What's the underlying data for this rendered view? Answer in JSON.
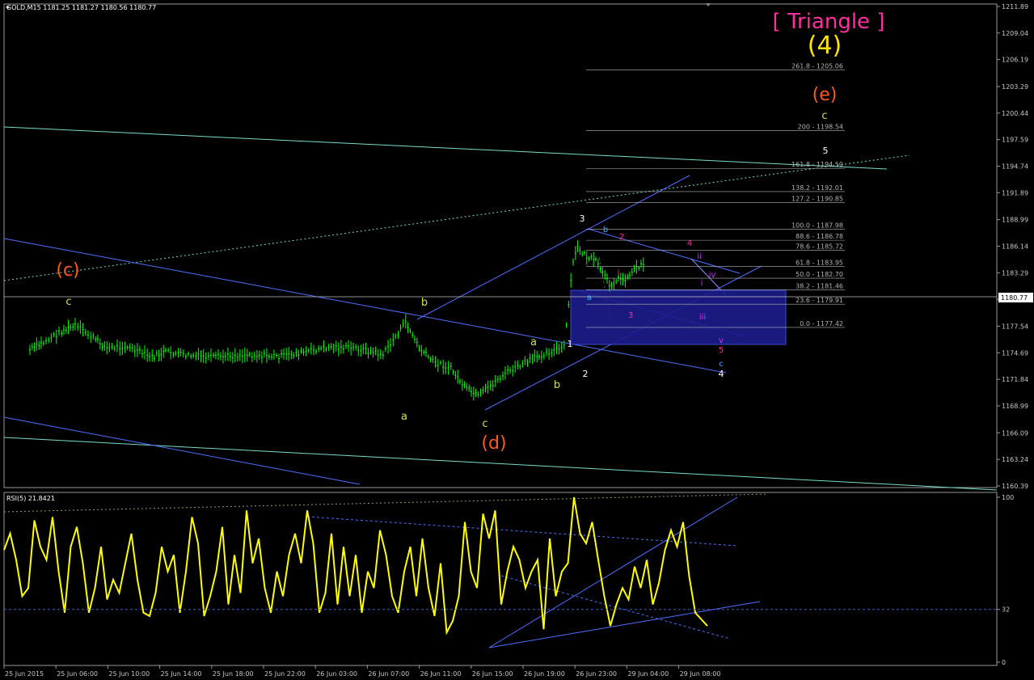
{
  "header": {
    "title": "GOLD,M15 1181.25 1181.27 1180.56 1180.77"
  },
  "rsi_header": {
    "title": "RSI(5) 21.8421"
  },
  "current_price_label": "1180.77",
  "chart_data": [
    {
      "type": "line",
      "name": "price",
      "y_ticks": [
        "1211.89",
        "1209.04",
        "1206.19",
        "1203.29",
        "1200.44",
        "1197.59",
        "1194.74",
        "1191.89",
        "1188.99",
        "1186.14",
        "1183.29",
        "1180.44",
        "1177.54",
        "1174.69",
        "1171.84",
        "1168.99",
        "1166.09",
        "1163.24",
        "1160.39"
      ],
      "ylim": [
        1160.39,
        1211.89
      ],
      "x_ticks": [
        "25 Jun 2015",
        "25 Jun 06:00",
        "25 Jun 10:00",
        "25 Jun 14:00",
        "25 Jun 18:00",
        "25 Jun 22:00",
        "26 Jun 03:00",
        "26 Jun 07:00",
        "26 Jun 11:00",
        "26 Jun 15:00",
        "26 Jun 19:00",
        "26 Jun 23:00",
        "29 Jun 04:00",
        "29 Jun 08:00"
      ],
      "x_index": [
        0,
        10,
        20,
        30,
        40,
        50,
        60,
        70,
        80,
        90,
        100,
        110,
        120,
        130,
        136
      ],
      "close": [
        1175.0,
        1175.8,
        1177.0,
        1177.6,
        1176.3,
        1175.2,
        1175.4,
        1174.2,
        1174.8,
        1174.4,
        1174.2,
        1174.5,
        1174.3,
        1174.8,
        1175.3,
        1175.2,
        1174.5,
        1178.0,
        1175.2,
        1173.8,
        1173.0,
        1171.0,
        1170.0,
        1172.5,
        1174.0,
        1174.5,
        1175.3,
        1184.5,
        1186.0,
        1185.0,
        1184.5,
        1182.0,
        1182.6,
        1182.7,
        1183.5,
        1184.5,
        1182.0,
        1180.77
      ],
      "fib_levels": [
        {
          "label": "261.8 - 1205.06",
          "value": 1205.06
        },
        {
          "label": "200 - 1198.54",
          "value": 1198.54
        },
        {
          "label": "161.8 - 1194.50",
          "value": 1194.5
        },
        {
          "label": "138.2 - 1192.01",
          "value": 1192.01
        },
        {
          "label": "127.2 - 1190.85",
          "value": 1190.85
        },
        {
          "label": "100.0 - 1187.98",
          "value": 1187.98
        },
        {
          "label": "88.6 - 1186.78",
          "value": 1186.78
        },
        {
          "label": "78.6 - 1185.72",
          "value": 1185.72
        },
        {
          "label": "61.8 - 1183.95",
          "value": 1183.95
        },
        {
          "label": "50.0 - 1182.70",
          "value": 1182.7
        },
        {
          "label": "38.2 - 1181.46",
          "value": 1181.46
        },
        {
          "label": "23.6 - 1179.91",
          "value": 1179.91
        },
        {
          "label": "0.0 - 1177.42",
          "value": 1177.42
        }
      ],
      "labels": [
        {
          "text": "[ Triangle ]",
          "color": "#ff2f9f",
          "size": 26
        },
        {
          "text": "(4)",
          "color": "#ffe600",
          "size": 30
        },
        {
          "text": "(e)",
          "color": "#ff5a1f",
          "size": 22
        },
        {
          "text": "(c)",
          "color": "#ff5a1f",
          "size": 22
        },
        {
          "text": "(d)",
          "color": "#ff5a1f",
          "size": 22
        },
        {
          "text": "c",
          "color": "#c8e64c",
          "size": 13
        },
        {
          "text": "a",
          "color": "#c8e64c",
          "size": 13
        },
        {
          "text": "b",
          "color": "#c8e64c",
          "size": 13
        },
        {
          "text": "c",
          "color": "#c8e64c",
          "size": 13
        },
        {
          "text": "a",
          "color": "#c8e64c",
          "size": 13
        },
        {
          "text": "b",
          "color": "#c8e64c",
          "size": 13
        },
        {
          "text": "c",
          "color": "#c8e64c",
          "size": 13
        },
        {
          "text": "1",
          "color": "#ffffff",
          "size": 11
        },
        {
          "text": "2",
          "color": "#ffffff",
          "size": 11
        },
        {
          "text": "3",
          "color": "#ffffff",
          "size": 11
        },
        {
          "text": "4",
          "color": "#ffffff",
          "size": 11
        },
        {
          "text": "5",
          "color": "#ffffff",
          "size": 11
        },
        {
          "text": "a",
          "color": "#44aaff",
          "size": 10
        },
        {
          "text": "b",
          "color": "#44aaff",
          "size": 10
        },
        {
          "text": "c",
          "color": "#44aaff",
          "size": 10
        },
        {
          "text": "2",
          "color": "#ff2f9f",
          "size": 10
        },
        {
          "text": "3",
          "color": "#ff2f9f",
          "size": 10
        },
        {
          "text": "4",
          "color": "#ff2f9f",
          "size": 10
        },
        {
          "text": "5",
          "color": "#ff2f9f",
          "size": 10
        },
        {
          "text": "i",
          "color": "#ff2f9f",
          "size": 10
        },
        {
          "text": "ii",
          "color": "#cc33ff",
          "size": 10
        },
        {
          "text": "iii",
          "color": "#cc33ff",
          "size": 10
        },
        {
          "text": "iv",
          "color": "#cc33ff",
          "size": 10
        },
        {
          "text": "v",
          "color": "#cc33ff",
          "size": 10
        },
        {
          "text": "i",
          "color": "#cc33ff",
          "size": 10
        }
      ],
      "colors": {
        "price": "#00ff00",
        "background": "#000000",
        "channel": "#4f6fff",
        "box": "#1c1c8c",
        "fib": "#b4b4b4",
        "current": "#c0c0c0",
        "teal": "#7adcc8"
      }
    },
    {
      "type": "line",
      "name": "RSI(5)",
      "y_ticks": [
        "100",
        "32",
        "0"
      ],
      "ylim": [
        0,
        100
      ],
      "rsi": [
        68,
        78,
        62,
        40,
        45,
        86,
        70,
        62,
        88,
        55,
        30,
        70,
        82,
        60,
        30,
        45,
        70,
        38,
        50,
        42,
        60,
        78,
        50,
        30,
        28,
        42,
        70,
        55,
        65,
        30,
        55,
        88,
        72,
        28,
        40,
        55,
        82,
        35,
        65,
        42,
        92,
        60,
        75,
        45,
        30,
        55,
        40,
        65,
        78,
        60,
        92,
        72,
        30,
        42,
        78,
        35,
        70,
        40,
        65,
        30,
        55,
        45,
        80,
        65,
        40,
        30,
        55,
        70,
        40,
        75,
        45,
        28,
        60,
        18,
        25,
        40,
        85,
        55,
        45,
        90,
        75,
        92,
        35,
        55,
        70,
        62,
        45,
        55,
        62,
        20,
        75,
        40,
        55,
        60,
        100,
        78,
        72,
        85,
        62,
        40,
        22,
        35,
        45,
        38,
        58,
        45,
        62,
        35,
        48,
        68,
        80,
        70,
        85,
        52,
        30,
        26,
        22
      ],
      "level": 32,
      "color": "#ffff00"
    }
  ]
}
